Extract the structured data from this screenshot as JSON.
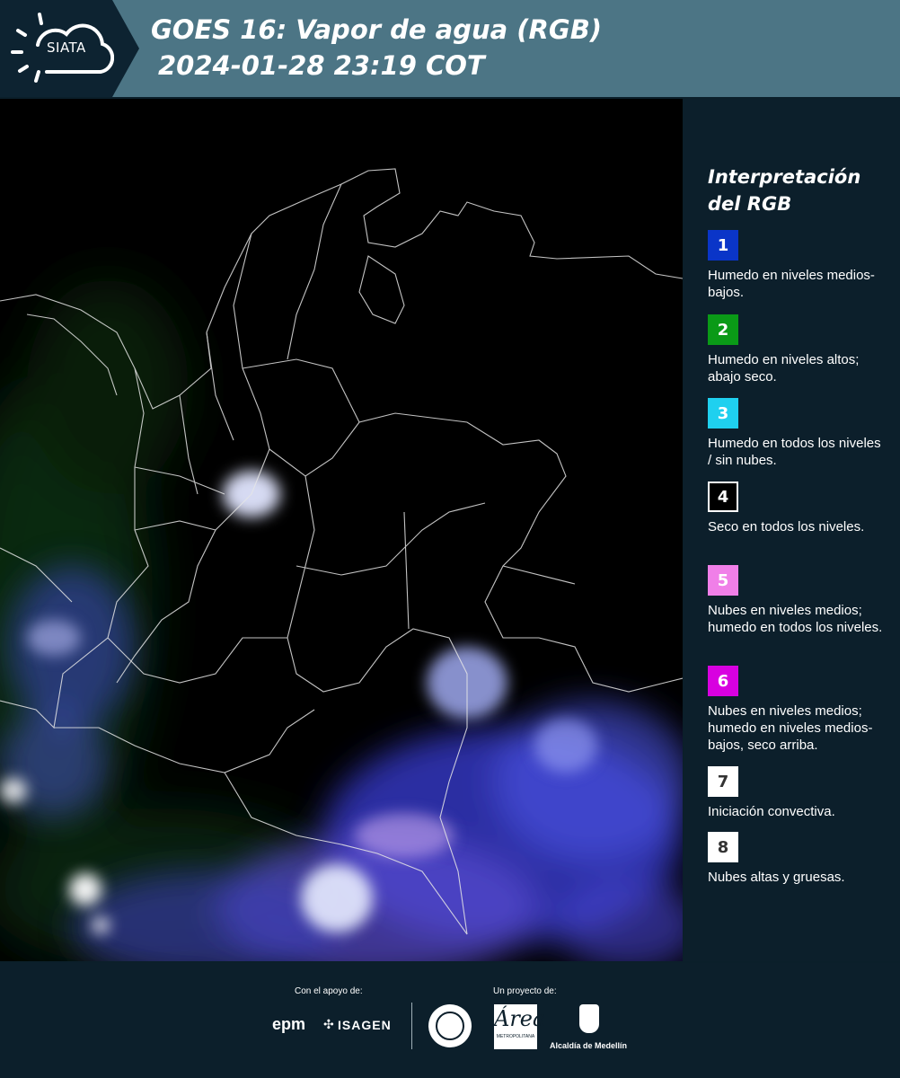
{
  "header": {
    "logo_text": "SIATA",
    "title_line1": "GOES 16: Vapor de agua (RGB)",
    "title_line2": "2024-01-28 23:19 COT"
  },
  "legend": {
    "title": "Interpretación del RGB",
    "items": [
      {
        "num": "1",
        "color": "#0a35c8",
        "text_color": "#ffffff",
        "label": "Humedo en niveles medios-bajos."
      },
      {
        "num": "2",
        "color": "#0a9a17",
        "text_color": "#ffffff",
        "label": "Humedo en niveles altos; abajo seco."
      },
      {
        "num": "3",
        "color": "#1fd0ef",
        "text_color": "#ffffff",
        "label": "Humedo en todos los niveles / sin nubes."
      },
      {
        "num": "4",
        "color": "#000000",
        "text_color": "#ffffff",
        "label": "Seco en todos los niveles."
      },
      {
        "num": "5",
        "color": "#f07fe8",
        "text_color": "#ffffff",
        "label": "Nubes en niveles medios; humedo en todos los niveles."
      },
      {
        "num": "6",
        "color": "#d800e0",
        "text_color": "#ffffff",
        "label": "Nubes en niveles medios; humedo en niveles medios-bajos, seco arriba."
      },
      {
        "num": "7",
        "color": "#ffffff",
        "text_color": "#333333",
        "label": "Iniciación convectiva."
      },
      {
        "num": "8",
        "color": "#ffffff",
        "text_color": "#333333",
        "label": "Nubes altas y gruesas."
      }
    ]
  },
  "footer": {
    "support_label": "Con el apoyo de:",
    "project_label": "Un proyecto de:",
    "epm": "epm",
    "isagen": "ISAGEN",
    "amva_letter": "Área",
    "amva_text": "METROPOLITANA",
    "medellin": "Alcaldía de Medellín"
  }
}
